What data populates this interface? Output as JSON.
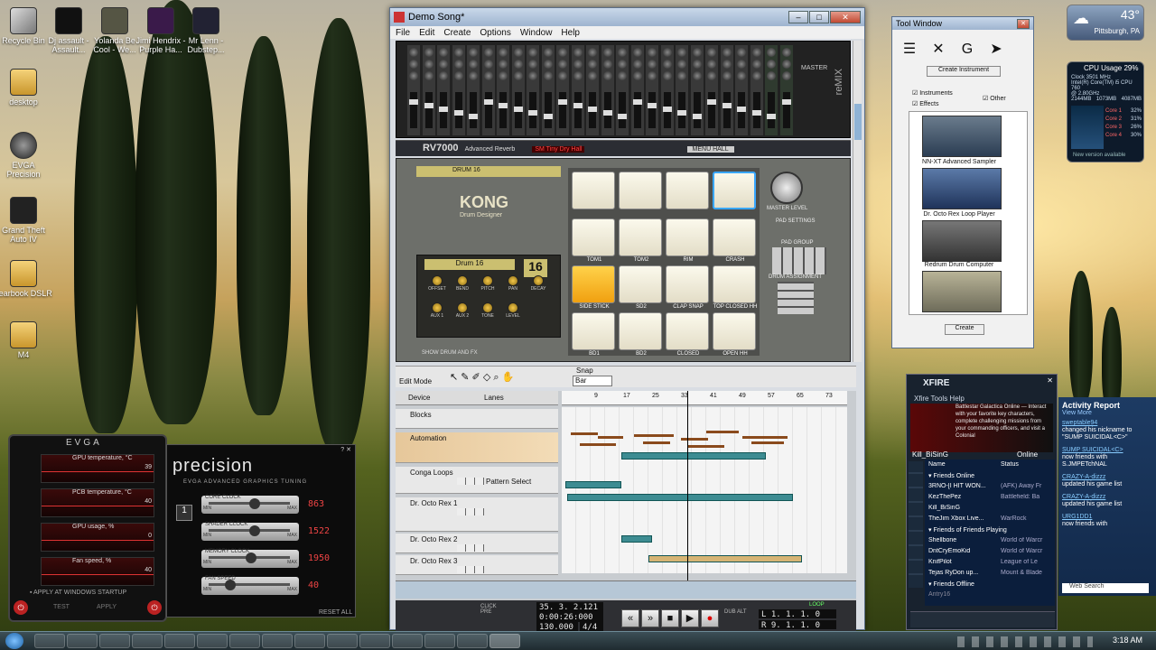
{
  "desktop": {
    "icons": [
      {
        "label": "Recycle Bin",
        "icon": "recycle-bin-icon"
      },
      {
        "label": "Dj assault - Assault...",
        "icon": "media-icon"
      },
      {
        "label": "Yolanda Be Cool - We...",
        "icon": "media-icon"
      },
      {
        "label": "Jimi Hendrix - Purple Ha...",
        "icon": "media-icon"
      },
      {
        "label": "Mr Lenn - Dubstep...",
        "icon": "media-icon"
      },
      {
        "label": "desktop",
        "icon": "folder-icon"
      },
      {
        "label": "EVGA Precision",
        "icon": "app-icon"
      },
      {
        "label": "Grand Theft Auto IV",
        "icon": "game-icon"
      },
      {
        "label": "yearbook DSLR",
        "icon": "folder-icon"
      },
      {
        "label": "M4",
        "icon": "folder-icon"
      }
    ]
  },
  "reason": {
    "title": "Demo Song*",
    "menu": [
      "File",
      "Edit",
      "Create",
      "Options",
      "Window",
      "Help"
    ],
    "mixer_label": "reMIX",
    "mixer_master": "MASTER",
    "rv7000": {
      "name": "RV7000",
      "sub": "Advanced Reverb",
      "preset": "SM Tiny Dry Hall",
      "menu": "MENU HALL"
    },
    "kong": {
      "display": "DRUM 16",
      "logo": "KONG",
      "logo_sub": "Drum Designer",
      "drum_name": "Drum 16",
      "drum_number": "16",
      "show_label": "SHOW DRUM AND FX",
      "master_level": "MASTER LEVEL",
      "pad_settings": "PAD SETTINGS",
      "pad_group": "PAD GROUP",
      "drum_assignment": "DRUM ASSIGNMENT",
      "knobs": [
        "OFFSET",
        "BEND",
        "PITCH",
        "PAN",
        "DECAY",
        "AUX 1",
        "AUX 2",
        "TONE",
        "LEVEL"
      ],
      "pad_labels": [
        "",
        "",
        "",
        "",
        "TOM1",
        "TOM2",
        "RIM",
        "CRASH",
        "SIDE STICK",
        "SD2",
        "CLAP SNAP",
        "TOP CLOSED HH",
        "BD1",
        "BD2",
        "CLOSED",
        "OPEN HH"
      ]
    },
    "sequencer": {
      "mode_edit": "Edit Mode",
      "snap_label": "Snap",
      "snap_value": "Bar",
      "device_label": "Device",
      "lanes_label": "Lanes",
      "ruler": [
        "9",
        "17",
        "25",
        "33",
        "41",
        "49",
        "57",
        "65",
        "73"
      ],
      "tracks": [
        {
          "name": "Blocks"
        },
        {
          "name": "Automation"
        },
        {
          "name": "Conga Loops",
          "extra": "Pattern Select"
        },
        {
          "name": "Dr. Octo Rex 1"
        },
        {
          "name": "Dr. Octo Rex 2"
        },
        {
          "name": "Dr. Octo Rex 3"
        }
      ]
    },
    "transport": {
      "position": "35. 3. 2.121",
      "time": "0:00:26:000",
      "tempo": "130.000",
      "signature": "4/4",
      "loop": "LOOP",
      "left": "L   1. 1. 1.   0",
      "right": "R   9. 1. 1.   0",
      "buttons": [
        "rewind",
        "fast-forward",
        "stop",
        "play",
        "record"
      ],
      "click_label": "CLICK",
      "pre_label": "PRE",
      "dub_alt": "DUB ALT"
    }
  },
  "tool_window": {
    "title": "Tool Window",
    "create_button": "Create Instrument",
    "filters": [
      {
        "label": "Instruments",
        "checked": true
      },
      {
        "label": "Effects",
        "checked": true
      },
      {
        "label": "Other",
        "checked": true
      }
    ],
    "devices": [
      "NN-XT Advanced Sampler",
      "Dr. Octo Rex Loop Player",
      "Redrum Drum Computer",
      ""
    ],
    "footer_button": "Create"
  },
  "weather": {
    "temp": "43°",
    "city": "Pittsburgh, PA"
  },
  "cpu_gadget": {
    "title": "CPU Usage",
    "value": "29%",
    "lines": [
      "Clock 3501 MHz",
      "Intel(R) Core(TM) i5 CPU 760",
      "@ 2.80GHz"
    ],
    "mem": [
      "2144MB",
      "1073MB",
      "4087MB"
    ],
    "cores": [
      {
        "label": "Core 1",
        "value": "32%"
      },
      {
        "label": "Core 2",
        "value": "31%"
      },
      {
        "label": "Core 3",
        "value": "26%"
      },
      {
        "label": "Core 4",
        "value": "30%"
      }
    ],
    "footer": "New version available"
  },
  "xfire": {
    "logo": "XFIRE",
    "menu": "Xfire  Tools  Help",
    "ad": "Battlestar Galactica Online — Interact with your favorite key characters, complete challenging missions from your commanding officers, and visit a Colonial",
    "user": "Kill_BiSinG",
    "status": "Online",
    "col_name": "Name",
    "col_status": "Status",
    "group1": "Friends Online",
    "friends": [
      {
        "name": "3RNO-[I HIT WON...",
        "status": "(AFK) Away Fr"
      },
      {
        "name": "KezThePez",
        "status": "Battlefield: Ba"
      },
      {
        "name": "Kill_BiSinG",
        "status": ""
      },
      {
        "name": "TheJim Xbox Live...",
        "status": "WarRock"
      }
    ],
    "group2": "Friends of Friends Playing",
    "fof": [
      {
        "name": "Shellbone",
        "status": "World of Warcr"
      },
      {
        "name": "DntCryEmoKid",
        "status": "World of Warcr"
      },
      {
        "name": "KnifPilot",
        "status": "League of Le"
      },
      {
        "name": "Tejas RyDon up...",
        "status": "Mount & Blade"
      }
    ],
    "group3": "Friends Offline",
    "offline": "Antry16"
  },
  "activity": {
    "title": "Activity Report",
    "view_more": "View More",
    "items": [
      {
        "user": "sweptable94",
        "text": "changed his nickname to \"SUMP SUICIDAL<C>\""
      },
      {
        "user": "SUMP SUICIDAL<C>",
        "text": "now friends with S.JMPETchNAL"
      },
      {
        "user": "CRAZY-A-dizzz",
        "text": "updated his game list"
      },
      {
        "user": "CRAZY-A-dizzz",
        "text": "updated his game list"
      },
      {
        "user": "URG1DD1",
        "text": "now friends with"
      }
    ],
    "search": "Web Search"
  },
  "evga": {
    "title": "EVGA",
    "graphs": [
      {
        "label": "GPU temperature, °C",
        "value": "39"
      },
      {
        "label": "PCB temperature, °C",
        "value": "40"
      },
      {
        "label": "GPU usage, %",
        "value": "0"
      },
      {
        "label": "Fan speed, %",
        "value": "40"
      }
    ],
    "apply_startup": "APPLY AT WINDOWS STARTUP",
    "test": "TEST",
    "apply": "APPLY"
  },
  "precision": {
    "title": "precision",
    "subtitle": "EVGA ADVANCED GRAPHICS TUNING",
    "gpu_index": "1",
    "sliders": [
      {
        "label": "CORE CLOCK",
        "value": "863",
        "pos": 0.5
      },
      {
        "label": "SHADER CLOCK",
        "value": "1522",
        "pos": 0.5
      },
      {
        "label": "MEMORY CLOCK",
        "value": "1950",
        "pos": 0.45
      },
      {
        "label": "FAN SPEED",
        "value": "40",
        "pos": 0.2
      }
    ],
    "min": "MIN",
    "max": "MAX",
    "reset": "RESET ALL"
  },
  "taskbar": {
    "clock": "3:18 AM"
  }
}
